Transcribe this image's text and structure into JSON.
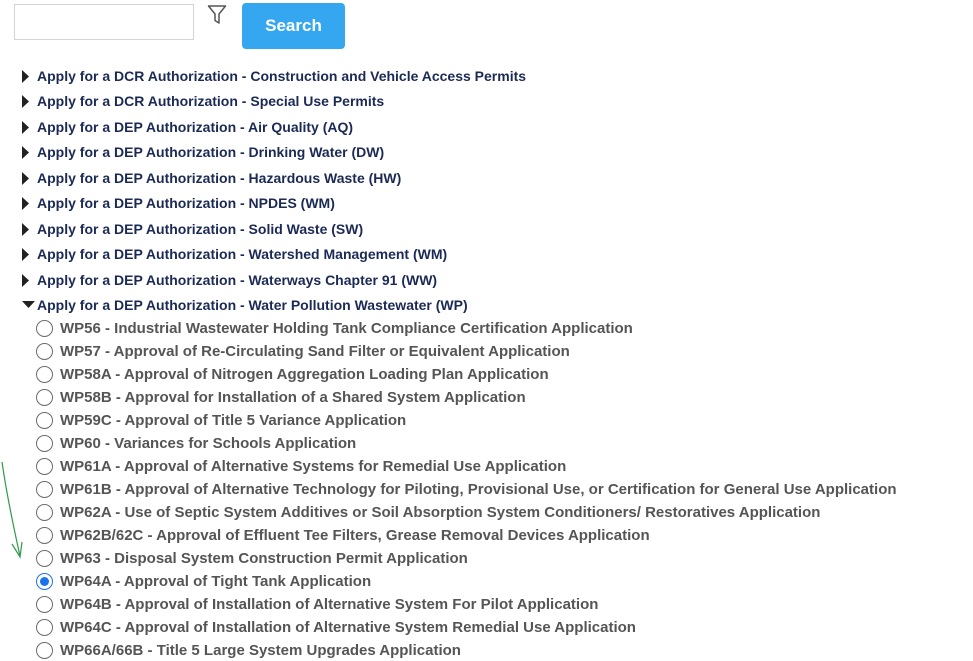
{
  "search": {
    "placeholder": "",
    "value": "",
    "button_label": "Search"
  },
  "icons": {
    "filter": "filter-icon",
    "collapsed": "caret-right-icon",
    "expanded": "caret-down-icon"
  },
  "colors": {
    "button": "#35a7f0",
    "link": "#1b2a55",
    "option_text": "#555555",
    "radio_selected": "#1a73e8",
    "annotation": "#2e9b4a"
  },
  "categories": [
    {
      "label": "Apply for a DCR Authorization - Construction and Vehicle Access Permits",
      "expanded": false
    },
    {
      "label": "Apply for a DCR Authorization - Special Use Permits",
      "expanded": false
    },
    {
      "label": "Apply for a DEP Authorization - Air Quality (AQ)",
      "expanded": false
    },
    {
      "label": "Apply for a DEP Authorization - Drinking Water (DW)",
      "expanded": false
    },
    {
      "label": "Apply for a DEP Authorization - Hazardous Waste (HW)",
      "expanded": false
    },
    {
      "label": "Apply for a DEP Authorization - NPDES (WM)",
      "expanded": false
    },
    {
      "label": "Apply for a DEP Authorization - Solid Waste (SW)",
      "expanded": false
    },
    {
      "label": "Apply for a DEP Authorization - Watershed Management (WM)",
      "expanded": false
    },
    {
      "label": "Apply for a DEP Authorization - Waterways Chapter 91 (WW)",
      "expanded": false
    },
    {
      "label": "Apply for a DEP Authorization - Water Pollution Wastewater (WP)",
      "expanded": true
    }
  ],
  "options": [
    {
      "text": "WP56 - Industrial Wastewater Holding Tank Compliance Certification Application",
      "selected": false
    },
    {
      "text": "WP57 - Approval of Re-Circulating Sand Filter or Equivalent Application",
      "selected": false
    },
    {
      "text": "WP58A - Approval of Nitrogen Aggregation Loading Plan Application",
      "selected": false
    },
    {
      "text": "WP58B - Approval for Installation of a Shared System Application",
      "selected": false
    },
    {
      "text": "WP59C - Approval of Title 5 Variance Application",
      "selected": false
    },
    {
      "text": "WP60 - Variances for Schools Application",
      "selected": false
    },
    {
      "text": "WP61A - Approval of Alternative Systems for Remedial Use Application",
      "selected": false
    },
    {
      "text": "WP61B - Approval of Alternative Technology for Piloting, Provisional Use, or Certification for General Use Application",
      "selected": false
    },
    {
      "text": "WP62A - Use of Septic System Additives or Soil Absorption System Conditioners/ Restoratives Application",
      "selected": false
    },
    {
      "text": "WP62B/62C - Approval of Effluent Tee Filters, Grease Removal Devices Application",
      "selected": false
    },
    {
      "text": "WP63 - Disposal System Construction Permit Application",
      "selected": false
    },
    {
      "text": "WP64A - Approval of Tight Tank Application",
      "selected": true
    },
    {
      "text": "WP64B - Approval of Installation of Alternative System For Pilot Application",
      "selected": false
    },
    {
      "text": "WP64C - Approval of Installation of Alternative System Remedial Use Application",
      "selected": false
    },
    {
      "text": "WP66A/66B - Title 5 Large System Upgrades Application",
      "selected": false
    }
  ]
}
